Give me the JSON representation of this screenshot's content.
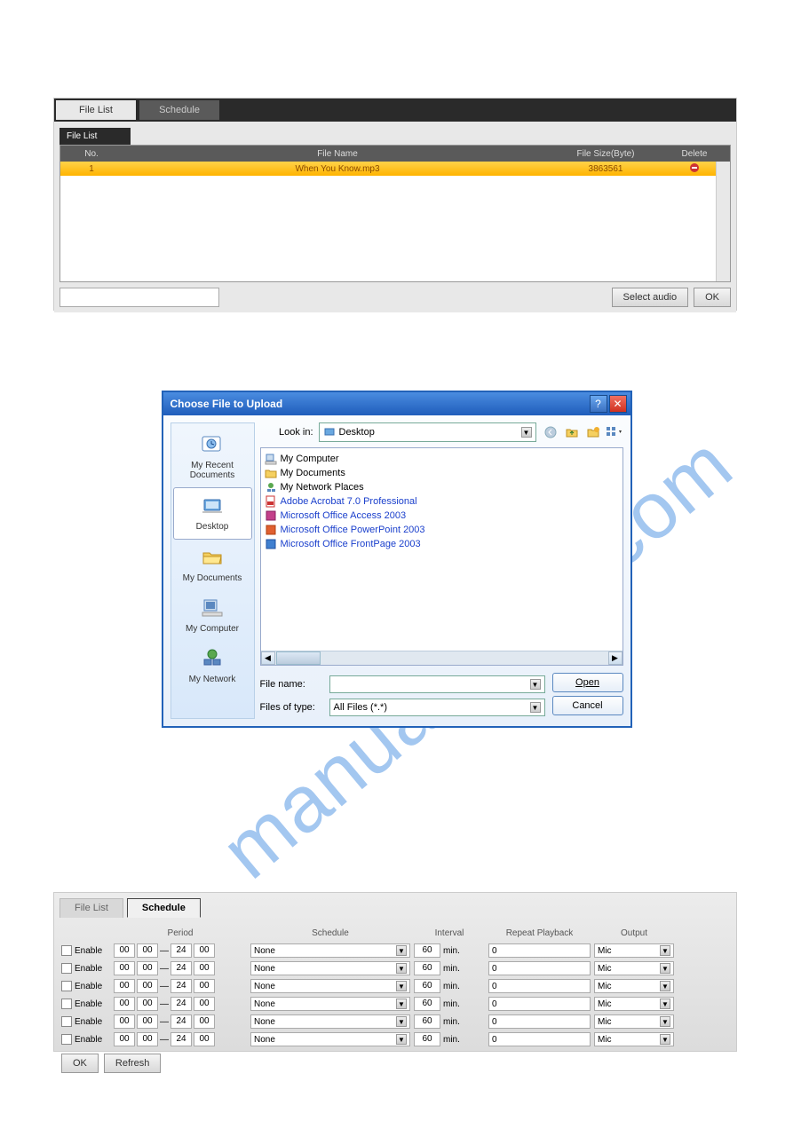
{
  "watermark": "manualshive.com",
  "panel1": {
    "tabs": {
      "active": "File List",
      "inactive": "Schedule"
    },
    "subtab": "File List",
    "columns": {
      "no": "No.",
      "filename": "File Name",
      "filesize": "File Size(Byte)",
      "delete": "Delete"
    },
    "row": {
      "no": "1",
      "filename": "When You Know.mp3",
      "filesize": "3863561"
    },
    "buttons": {
      "select": "Select audio",
      "ok": "OK"
    }
  },
  "dialog": {
    "title": "Choose File to Upload",
    "lookin_label": "Look in:",
    "lookin_value": "Desktop",
    "sidebar": {
      "recent": "My Recent Documents",
      "desktop": "Desktop",
      "mydocs": "My Documents",
      "mycomp": "My Computer",
      "mynet": "My Network"
    },
    "files": {
      "mycomputer": "My Computer",
      "mydocuments": "My Documents",
      "mynetwork": "My Network Places",
      "acrobat": "Adobe Acrobat 7.0 Professional",
      "access": "Microsoft Office Access 2003",
      "powerpoint": "Microsoft Office PowerPoint 2003",
      "frontpage": "Microsoft Office FrontPage 2003"
    },
    "filename_label": "File name:",
    "filename_value": "",
    "filetype_label": "Files of type:",
    "filetype_value": "All Files (*.*)",
    "open": "Open",
    "cancel": "Cancel"
  },
  "panel3": {
    "tabs": {
      "filelist": "File List",
      "schedule": "Schedule"
    },
    "head": {
      "enable": "",
      "period": "Period",
      "schedule": "Schedule",
      "interval": "Interval",
      "repeat": "Repeat Playback",
      "output": "Output"
    },
    "enable_label": "Enable",
    "row": {
      "p1": "00",
      "p2": "00",
      "dash": "—",
      "p3": "24",
      "p4": "00",
      "schedule": "None",
      "interval": "60",
      "min": "min.",
      "repeat": "0",
      "output": "Mic"
    },
    "buttons": {
      "ok": "OK",
      "refresh": "Refresh"
    }
  }
}
